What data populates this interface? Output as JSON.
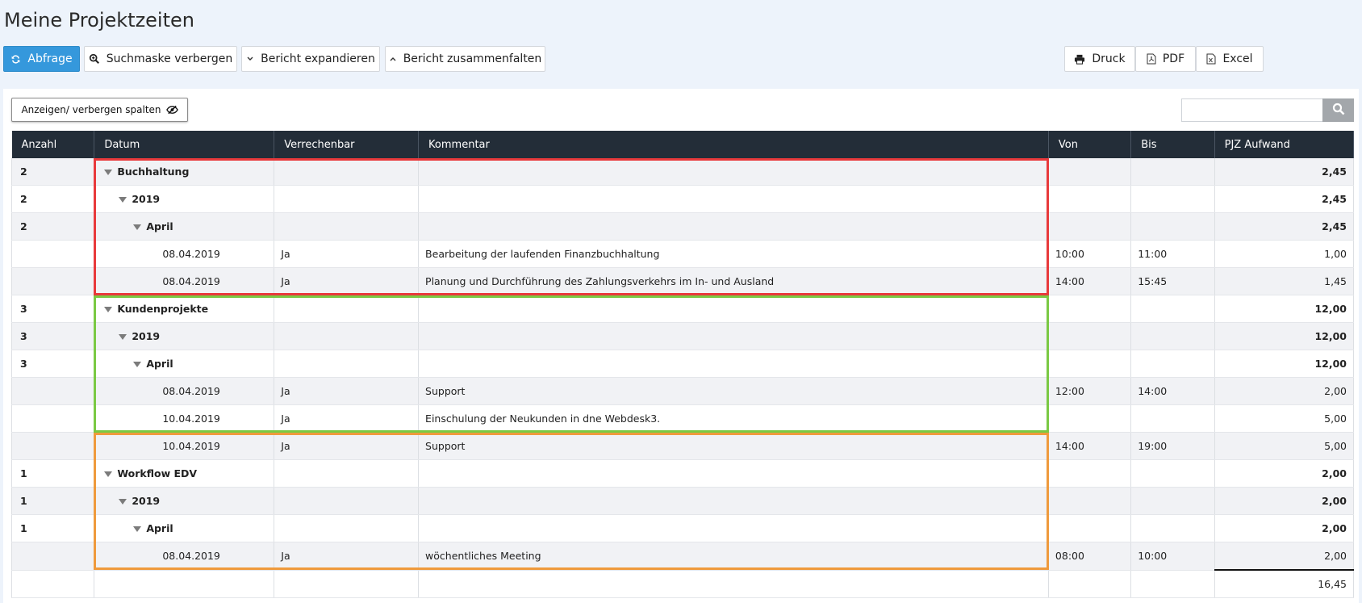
{
  "page": {
    "title": "Meine Projektzeiten"
  },
  "toolbar": {
    "abfrage": "Abfrage",
    "hide_search": "Suchmaske verbergen",
    "expand": "Bericht expandieren",
    "collapse": "Bericht zusammenfalten",
    "print": "Druck",
    "pdf": "PDF",
    "excel": "Excel"
  },
  "panel": {
    "columns_toggle": "Anzeigen/ verbergen spalten",
    "search_placeholder": ""
  },
  "table": {
    "headers": [
      "Anzahl",
      "Datum",
      "Verrechenbar",
      "Kommentar",
      "Von",
      "Bis",
      "PJZ Aufwand"
    ],
    "rows": [
      {
        "type": "group",
        "level": 1,
        "anzahl": "2",
        "label": "Buchhaltung",
        "aufwand": "2,45"
      },
      {
        "type": "group",
        "level": 2,
        "anzahl": "2",
        "label": "2019",
        "aufwand": "2,45"
      },
      {
        "type": "group",
        "level": 3,
        "anzahl": "2",
        "label": "April",
        "aufwand": "2,45"
      },
      {
        "type": "entry",
        "datum": "08.04.2019",
        "verrechenbar": "Ja",
        "kommentar": "Bearbeitung der laufenden Finanzbuchhaltung",
        "von": "10:00",
        "bis": "11:00",
        "aufwand": "1,00"
      },
      {
        "type": "entry",
        "datum": "08.04.2019",
        "verrechenbar": "Ja",
        "kommentar": "Planung und Durchführung des Zahlungsverkehrs im In- und Ausland",
        "von": "14:00",
        "bis": "15:45",
        "aufwand": "1,45"
      },
      {
        "type": "group",
        "level": 1,
        "anzahl": "3",
        "label": "Kundenprojekte",
        "aufwand": "12,00"
      },
      {
        "type": "group",
        "level": 2,
        "anzahl": "3",
        "label": "2019",
        "aufwand": "12,00"
      },
      {
        "type": "group",
        "level": 3,
        "anzahl": "3",
        "label": "April",
        "aufwand": "12,00"
      },
      {
        "type": "entry",
        "datum": "08.04.2019",
        "verrechenbar": "Ja",
        "kommentar": "Support",
        "von": "12:00",
        "bis": "14:00",
        "aufwand": "2,00"
      },
      {
        "type": "entry",
        "datum": "10.04.2019",
        "verrechenbar": "Ja",
        "kommentar": "Einschulung der Neukunden in dne Webdesk3.",
        "von": "",
        "bis": "",
        "aufwand": "5,00"
      },
      {
        "type": "entry",
        "datum": "10.04.2019",
        "verrechenbar": "Ja",
        "kommentar": "Support",
        "von": "14:00",
        "bis": "19:00",
        "aufwand": "5,00"
      },
      {
        "type": "group",
        "level": 1,
        "anzahl": "1",
        "label": "Workflow EDV",
        "aufwand": "2,00"
      },
      {
        "type": "group",
        "level": 2,
        "anzahl": "1",
        "label": "2019",
        "aufwand": "2,00"
      },
      {
        "type": "group",
        "level": 3,
        "anzahl": "1",
        "label": "April",
        "aufwand": "2,00"
      },
      {
        "type": "entry",
        "datum": "08.04.2019",
        "verrechenbar": "Ja",
        "kommentar": "wöchentliches Meeting",
        "von": "08:00",
        "bis": "10:00",
        "aufwand": "2,00"
      }
    ],
    "total": "16,45"
  },
  "highlights": [
    {
      "name": "highlight-buchhaltung",
      "color": "#e8393b"
    },
    {
      "name": "highlight-kundenprojekte",
      "color": "#7ac943"
    },
    {
      "name": "highlight-workflow",
      "color": "#ef9a3c"
    }
  ]
}
